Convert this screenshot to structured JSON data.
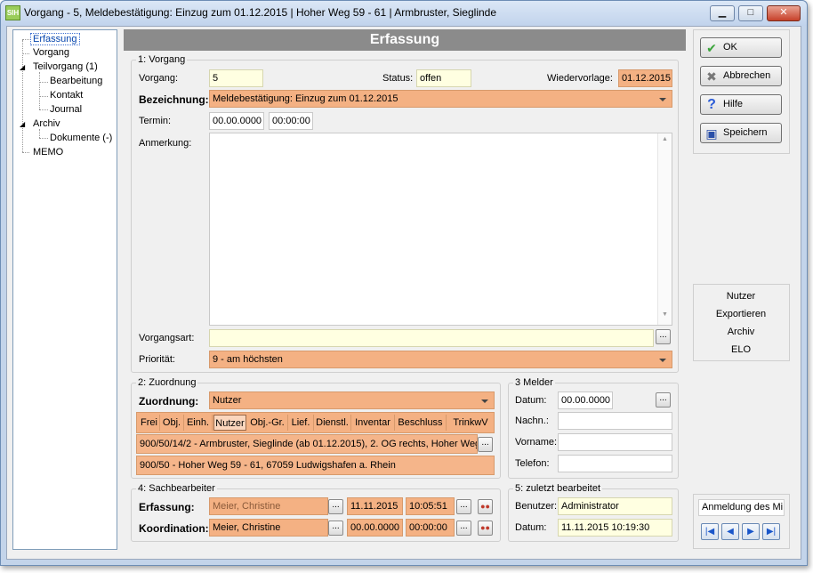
{
  "window": {
    "title": "Vorgang - 5, Meldebestätigung: Einzug zum 01.12.2015 | Hoher Weg 59 - 61 | Armbruster, Sieglinde",
    "icon_text": "SIH"
  },
  "tree": {
    "items": [
      {
        "label": "Erfassung"
      },
      {
        "label": "Vorgang"
      },
      {
        "label": "Teilvorgang (1)"
      },
      {
        "label": "Bearbeitung"
      },
      {
        "label": "Kontakt"
      },
      {
        "label": "Journal"
      },
      {
        "label": "Archiv"
      },
      {
        "label": "Dokumente (-)"
      },
      {
        "label": "MEMO"
      }
    ]
  },
  "header": {
    "title": "Erfassung"
  },
  "vorgang_group": {
    "label": "1: Vorgang",
    "vorgang_label": "Vorgang:",
    "vorgang_value": "5",
    "status_label": "Status:",
    "status_value": "offen",
    "wiedervorlage_label": "Wiedervorlage:",
    "wiedervorlage_value": "01.12.2015",
    "bezeichnung_label": "Bezeichnung:",
    "bezeichnung_value": "Meldebestätigung: Einzug zum 01.12.2015",
    "termin_label": "Termin:",
    "termin_date": "00.00.0000",
    "termin_time": "00:00:00",
    "anmerkung_label": "Anmerkung:",
    "anmerkung_value": "",
    "vorgangsart_label": "Vorgangsart:",
    "vorgangsart_value": "",
    "prioritaet_label": "Priorität:",
    "prioritaet_value": "9 - am höchsten"
  },
  "zuordnung_group": {
    "label": "2: Zuordnung",
    "zuordnung_label": "Zuordnung:",
    "zuordnung_value": "Nutzer",
    "tabs": [
      "Frei",
      "Obj.",
      "Einh.",
      "Nutzer",
      "Obj.-Gr.",
      "Lief.",
      "Dienstl.",
      "Inventar",
      "Beschluss",
      "TrinkwV"
    ],
    "selected_tab": "Nutzer",
    "rows": [
      "900/50/14/2 - Armbruster, Sieglinde  (ab 01.12.2015), 2. OG rechts, Hoher Weg",
      "900/50 - Hoher Weg 59 - 61, 67059 Ludwigshafen a. Rhein"
    ]
  },
  "melder_group": {
    "label": "3 Melder",
    "datum_label": "Datum:",
    "datum_value": "00.00.0000",
    "nachn_label": "Nachn.:",
    "nachn_value": "",
    "vorname_label": "Vorname:",
    "vorname_value": "",
    "telefon_label": "Telefon:",
    "telefon_value": ""
  },
  "sachbearbeiter_group": {
    "label": "4: Sachbearbeiter",
    "erfassung_label": "Erfassung:",
    "erfassung_name": "Meier, Christine",
    "erfassung_date": "11.11.2015",
    "erfassung_time": "10:05:51",
    "koordination_label": "Koordination:",
    "koordination_name": "Meier, Christine",
    "koordination_date": "00.00.0000",
    "koordination_time": "00:00:00"
  },
  "zuletzt_group": {
    "label": "5: zuletzt bearbeitet",
    "benutzer_label": "Benutzer:",
    "benutzer_value": "Administrator",
    "datum_label": "Datum:",
    "datum_value": "11.11.2015 10:19:30"
  },
  "buttons": {
    "ok": "OK",
    "abbrechen": "Abbrechen",
    "hilfe": "Hilfe",
    "speichern": "Speichern"
  },
  "right_menu": [
    "Nutzer",
    "Exportieren",
    "Archiv",
    "ELO"
  ],
  "anmeldung": {
    "label": "Anmeldung des Mi"
  },
  "dots_label": "...",
  "colors": {
    "orange_field": "#f4b183",
    "yellow_field": "#ffffe1",
    "header_bg": "#8b8b8b"
  }
}
